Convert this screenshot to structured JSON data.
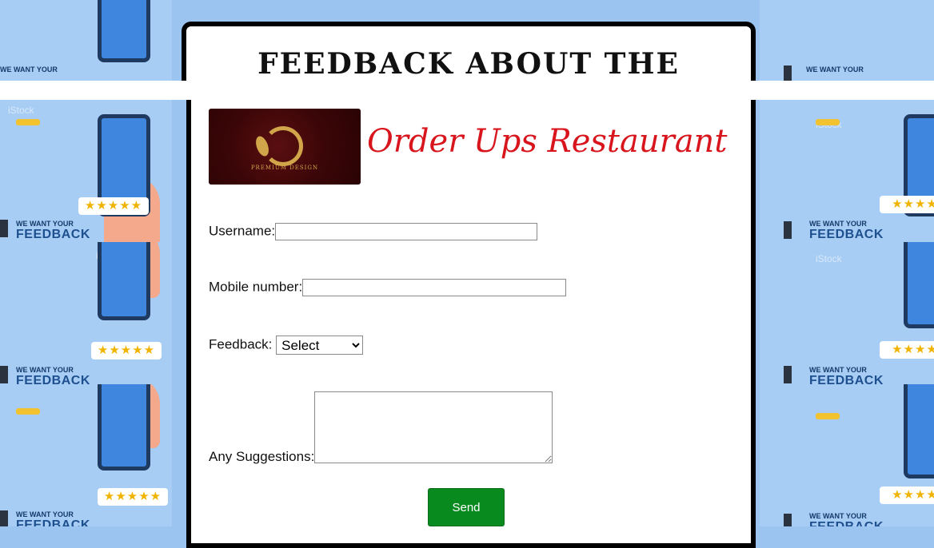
{
  "page": {
    "title": "Feedback about the",
    "background_color": "#9cc4f0"
  },
  "background": {
    "tile_strings": {
      "watermark": "iStock",
      "heading_small": "WE WANT YOUR",
      "heading_big": "FEEDBACK",
      "stars": "★★★★★"
    },
    "tile_strings_partial": {
      "heading_small": "WE WANT YOUR",
      "stars": "★★★★"
    }
  },
  "brand": {
    "name": "Order Ups Restaurant",
    "color": "#d8151c",
    "logo_caption": "PREMIUM DESIGN"
  },
  "form": {
    "username_label": "Username:",
    "username_value": "",
    "mobile_label": "Mobile number:",
    "mobile_value": "",
    "feedback_label": "Feedback:",
    "feedback_selected": "Select",
    "suggestions_label": "Any Suggestions:",
    "suggestions_value": "",
    "send_label": "Send",
    "send_color": "#088a1f"
  }
}
